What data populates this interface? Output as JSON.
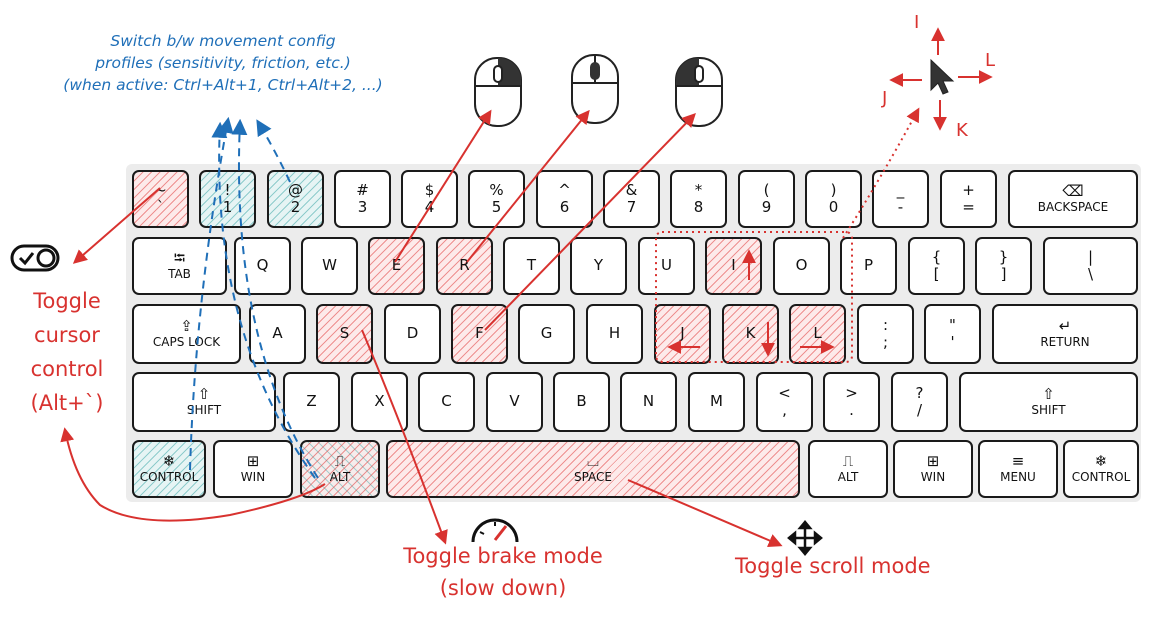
{
  "annotations": {
    "profiles": [
      "Switch b/w movement config",
      "profiles (sensitivity, friction, etc.)",
      "(when active: Ctrl+Alt+1, Ctrl+Alt+2, ...)"
    ],
    "cursor": [
      "Toggle",
      "cursor",
      "control",
      "(Alt+`)"
    ],
    "brake": [
      "Toggle brake mode",
      "(slow down)"
    ],
    "scroll": "Toggle scroll mode",
    "directions": {
      "up": "I",
      "right": "L",
      "left": "J",
      "down": "K"
    }
  },
  "colors": {
    "red": "#d8322f",
    "blue": "#1f6fb8",
    "key_border": "#1a1a1a",
    "red_hatch": "#e14646",
    "blue_hatch": "#46aaaa"
  },
  "icons": [
    "toggle-switch-icon",
    "mouse-right-click-icon",
    "mouse-middle-click-icon",
    "mouse-left-click-icon",
    "cursor-arrow-icon",
    "speedometer-icon",
    "move-arrows-icon"
  ],
  "keyboard": {
    "row1": [
      {
        "top": "~",
        "bottom": "`",
        "hl": "red"
      },
      {
        "top": "!",
        "bottom": "1",
        "hl": "blue"
      },
      {
        "top": "@",
        "bottom": "2",
        "hl": "blue"
      },
      {
        "top": "#",
        "bottom": "3"
      },
      {
        "top": "$",
        "bottom": "4"
      },
      {
        "top": "%",
        "bottom": "5"
      },
      {
        "top": "^",
        "bottom": "6"
      },
      {
        "top": "&",
        "bottom": "7"
      },
      {
        "top": "*",
        "bottom": "8"
      },
      {
        "top": "(",
        "bottom": "9"
      },
      {
        "top": ")",
        "bottom": "0"
      },
      {
        "top": "_",
        "bottom": "-"
      },
      {
        "top": "+",
        "bottom": "="
      },
      {
        "top": "⌫",
        "bottom": "BACKSPACE"
      }
    ],
    "row2": [
      {
        "top": "⭾",
        "bottom": "TAB"
      },
      {
        "label": "Q"
      },
      {
        "label": "W"
      },
      {
        "label": "E",
        "hl": "red"
      },
      {
        "label": "R",
        "hl": "red"
      },
      {
        "label": "T"
      },
      {
        "label": "Y"
      },
      {
        "label": "U"
      },
      {
        "label": "I",
        "hl": "red"
      },
      {
        "label": "O"
      },
      {
        "label": "P"
      },
      {
        "top": "{",
        "bottom": "["
      },
      {
        "top": "}",
        "bottom": "]"
      },
      {
        "top": "|",
        "bottom": "\\"
      }
    ],
    "row3": [
      {
        "top": "⇪",
        "bottom": "CAPS LOCK"
      },
      {
        "label": "A"
      },
      {
        "label": "S",
        "hl": "red"
      },
      {
        "label": "D"
      },
      {
        "label": "F",
        "hl": "red"
      },
      {
        "label": "G"
      },
      {
        "label": "H"
      },
      {
        "label": "J",
        "hl": "red"
      },
      {
        "label": "K",
        "hl": "red"
      },
      {
        "label": "L",
        "hl": "red"
      },
      {
        "top": ":",
        "bottom": ";"
      },
      {
        "top": "\"",
        "bottom": "'"
      },
      {
        "top": "↵",
        "bottom": "RETURN"
      }
    ],
    "row4": [
      {
        "top": "⇧",
        "bottom": "SHIFT"
      },
      {
        "label": "Z"
      },
      {
        "label": "X"
      },
      {
        "label": "C"
      },
      {
        "label": "V"
      },
      {
        "label": "B"
      },
      {
        "label": "N"
      },
      {
        "label": "M"
      },
      {
        "top": "<",
        "bottom": ","
      },
      {
        "top": ">",
        "bottom": "."
      },
      {
        "top": "?",
        "bottom": "/"
      },
      {
        "top": "⇧",
        "bottom": "SHIFT"
      }
    ],
    "row5": [
      {
        "top": "❄",
        "bottom": "CONTROL",
        "hl": "blue"
      },
      {
        "top": "⊞",
        "bottom": "WIN"
      },
      {
        "top": "⎍",
        "bottom": "ALT",
        "hl": "mix"
      },
      {
        "top": "⌴",
        "bottom": "SPACE",
        "hl": "red"
      },
      {
        "top": "⎍",
        "bottom": "ALT"
      },
      {
        "top": "⊞",
        "bottom": "WIN"
      },
      {
        "top": "≡",
        "bottom": "MENU"
      },
      {
        "top": "❄",
        "bottom": "CONTROL"
      }
    ]
  }
}
